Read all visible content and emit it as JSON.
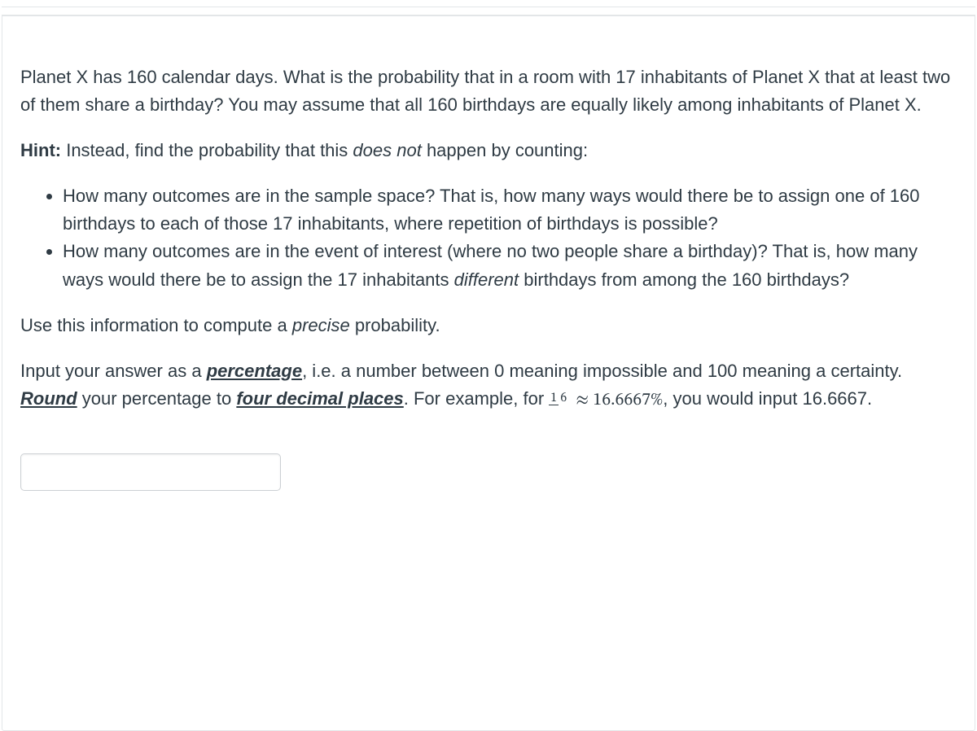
{
  "problem": {
    "para1": "Planet X has 160 calendar days. What is the probability that in a room with 17 inhabitants of Planet X that at least two of them share a birthday? You may assume that all 160 birthdays are equally likely among inhabitants of Planet X.",
    "hint_label": "Hint:",
    "hint_text_before": " Instead, find the probability that this ",
    "hint_em": "does not",
    "hint_text_after": " happen by counting:",
    "bullets": {
      "b1": "How many outcomes are in the sample space? That is, how many ways would there be to assign one of 160 birthdays to each of those 17 inhabitants, where repetition of birthdays is possible?",
      "b2_before": "How many outcomes are in the event of interest (where no two people share a birthday)? That is, how many ways would there be to assign the 17 inhabitants ",
      "b2_em": "different",
      "b2_after": " birthdays from among the 160 birthdays?"
    },
    "para3_before": "Use this information to compute a ",
    "para3_em": "precise",
    "para3_after": " probability.",
    "instr": {
      "p1": "Input your answer as a ",
      "pct_word": "percentage",
      "p2": ", i.e. a number between 0 meaning impossible and 100 meaning a certainty. ",
      "round_word": "Round",
      "p3": " your percentage to ",
      "four_dec": "four decimal places",
      "p4": ". For example, for ",
      "frac_num": "1",
      "frac_den": "6",
      "approx": " ≈ 16.6667%",
      "p5": ", you would input 16.6667."
    }
  },
  "answer_value": ""
}
